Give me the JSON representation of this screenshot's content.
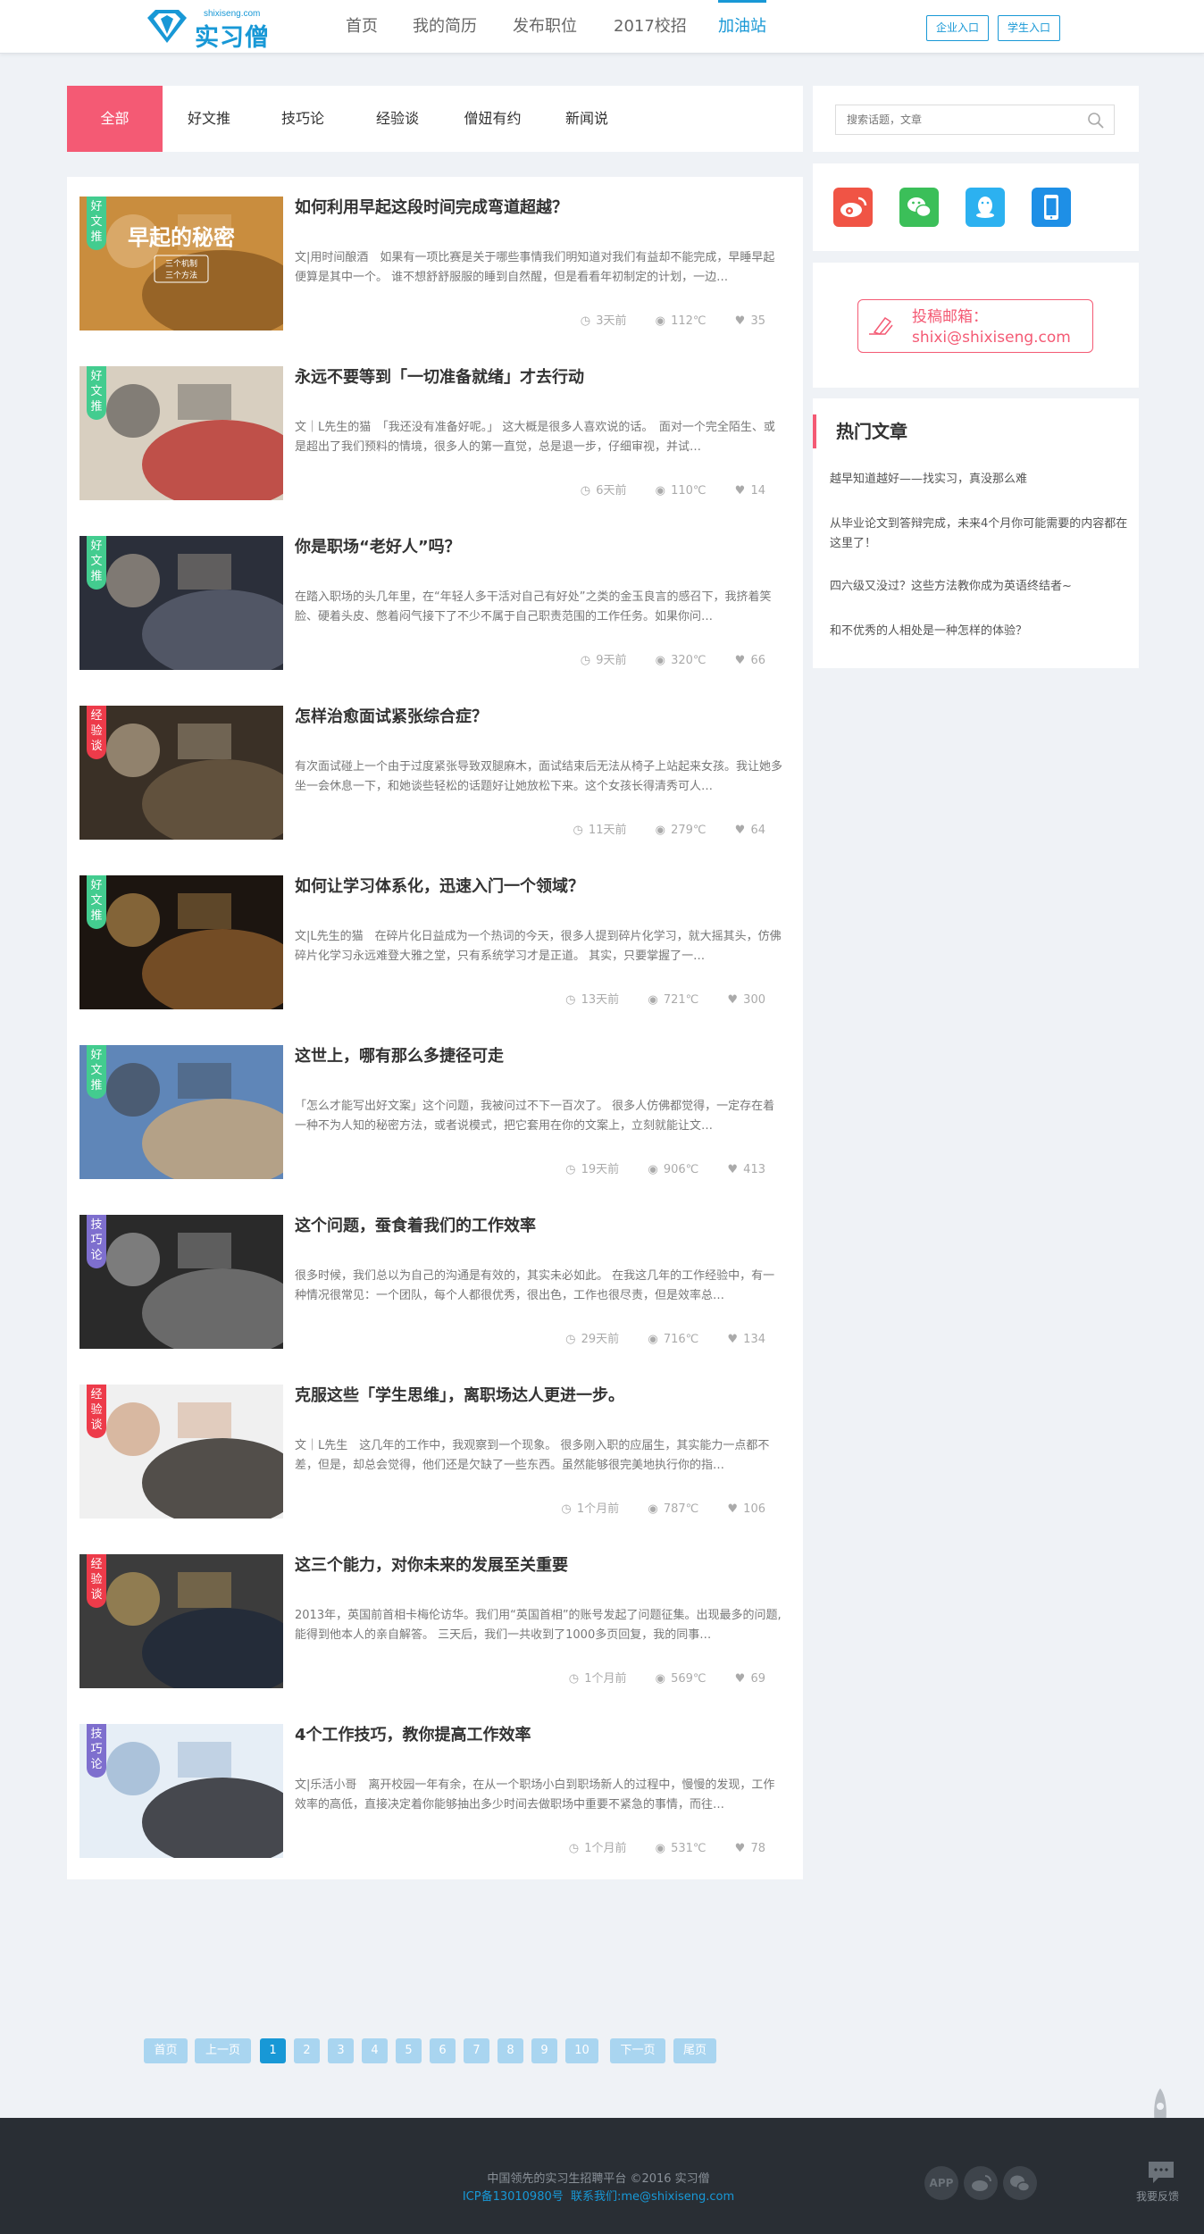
{
  "header": {
    "logo_url": "shixiseng.com",
    "logo_text": "实习僧",
    "nav": [
      "首页",
      "我的简历",
      "发布职位",
      "2017校招",
      "加油站"
    ],
    "enterprise_btn": "企业入口",
    "student_btn": "学生入口"
  },
  "tabs": [
    "全部",
    "好文推",
    "技巧论",
    "经验谈",
    "僧妞有约",
    "新闻说"
  ],
  "articles": [
    {
      "title": "如何利用早起这段时间完成弯道超越？",
      "excerpt": "文|用时间酿酒　如果有一项比赛是关于哪些事情我们明知道对我们有益却不能完成，早睡早起便算是其中一个。 谁不想舒舒服服的睡到自然醒，但是看看年初制定的计划，一边…",
      "badge": "好文推",
      "time": "3天前",
      "views": "112℃",
      "likes": "35",
      "thumb_title": "早起的秘密",
      "thumb_sub1": "三个机制",
      "thumb_sub2": "三个方法"
    },
    {
      "title": "永远不要等到「一切准备就绪」才去行动",
      "excerpt": "文｜L先生的猫　「我还没有准备好呢。」 这大概是很多人喜欢说的话。　面对一个完全陌生、或是超出了我们预料的情境，很多人的第一直觉，总是退一步，仔细审视，并试…",
      "badge": "好文推",
      "time": "6天前",
      "views": "110℃",
      "likes": "14"
    },
    {
      "title": "你是职场“老好人”吗？",
      "excerpt": "在踏入职场的头几年里，在“年轻人多干活对自己有好处”之类的金玉良言的感召下，我挤着笑脸、硬着头皮、憋着闷气接下了不少不属于自己职责范围的工作任务。如果你问…",
      "badge": "好文推",
      "time": "9天前",
      "views": "320℃",
      "likes": "66"
    },
    {
      "title": "怎样治愈面试紧张综合症？",
      "excerpt": "有次面试碰上一个由于过度紧张导致双腿麻木，面试结束后无法从椅子上站起来女孩。我让她多坐一会休息一下，和她谈些轻松的话题好让她放松下来。这个女孩长得清秀可人…",
      "badge": "经验谈",
      "time": "11天前",
      "views": "279℃",
      "likes": "64"
    },
    {
      "title": "如何让学习体系化，迅速入门一个领域？",
      "excerpt": "文|L先生的猫　在碎片化日益成为一个热词的今天，很多人提到碎片化学习，就大摇其头，仿佛碎片化学习永远难登大雅之堂，只有系统学习才是正道。 其实，只要掌握了一…",
      "badge": "好文推",
      "time": "13天前",
      "views": "721℃",
      "likes": "300"
    },
    {
      "title": "这世上，哪有那么多捷径可走",
      "excerpt": "「怎么才能写出好文案」这个问题，我被问过不下一百次了。 很多人仿佛都觉得，一定存在着一种不为人知的秘密方法，或者说模式，把它套用在你的文案上，立刻就能让文…",
      "badge": "好文推",
      "time": "19天前",
      "views": "906℃",
      "likes": "413"
    },
    {
      "title": "这个问题，蚕食着我们的工作效率",
      "excerpt": "很多时候，我们总以为自己的沟通是有效的，其实未必如此。 在我这几年的工作经验中，有一种情况很常见：一个团队，每个人都很优秀，很出色，工作也很尽责，但是效率总…",
      "badge": "技巧论",
      "time": "29天前",
      "views": "716℃",
      "likes": "134"
    },
    {
      "title": "克服这些「学生思维」，离职场达人更进一步。",
      "excerpt": "文｜L先生　这几年的工作中，我观察到一个现象。 很多刚入职的应届生，其实能力一点都不差，但是，却总会觉得，他们还是欠缺了一些东西。虽然能够很完美地执行你的指…",
      "badge": "经验谈",
      "time": "1个月前",
      "views": "787℃",
      "likes": "106"
    },
    {
      "title": "这三个能力，对你未来的发展至关重要",
      "excerpt": "2013年，英国前首相卡梅伦访华。我们用“英国首相”的账号发起了问题征集。出现最多的问题,能得到他本人的亲自解答。 三天后，我们一共收到了1000多页回复，我的同事…",
      "badge": "经验谈",
      "time": "1个月前",
      "views": "569℃",
      "likes": "69"
    },
    {
      "title": "4个工作技巧，教你提高工作效率",
      "excerpt": "文|乐活小哥　离开校园一年有余，在从一个职场小白到职场新人的过程中，慢慢的发现，工作效率的高低，直接决定着你能够抽出多少时间去做职场中重要不紧急的事情，而往…",
      "badge": "技巧论",
      "time": "1个月前",
      "views": "531℃",
      "likes": "78"
    }
  ],
  "pagination": [
    "首页",
    "上一页",
    "1",
    "2",
    "3",
    "4",
    "5",
    "6",
    "7",
    "8",
    "9",
    "10",
    "下一页",
    "尾页"
  ],
  "sidebar": {
    "search_placeholder": "搜索话题，文章",
    "social": [
      "weibo-icon",
      "wechat-icon",
      "qq-icon",
      "mobile-icon"
    ],
    "contribute_label": "投稿邮箱：",
    "contribute_email": "shixi@shixiseng.com",
    "hot_title": "热门文章",
    "hot_articles": [
      "越早知道越好——找实习，真没那么难",
      "从毕业论文到答辩完成，未来4个月你可能需要的内容都在这里了！",
      "四六级又没过？这些方法教你成为英语终结者~",
      "和不优秀的人相处是一种怎样的体验？"
    ]
  },
  "footer": {
    "line1": "中国领先的实习生招聘平台 ©2016 实习僧",
    "icp": "ICP备13010980号",
    "contact": "联系我们:me@shixiseng.com",
    "icon_app": "APP",
    "feedback": "我要反馈"
  },
  "colors": {
    "accent": "#1898d6",
    "pink": "#f45a74",
    "green": "#43cc8f",
    "red": "#ed3b4a",
    "purple": "#7e6fce"
  }
}
